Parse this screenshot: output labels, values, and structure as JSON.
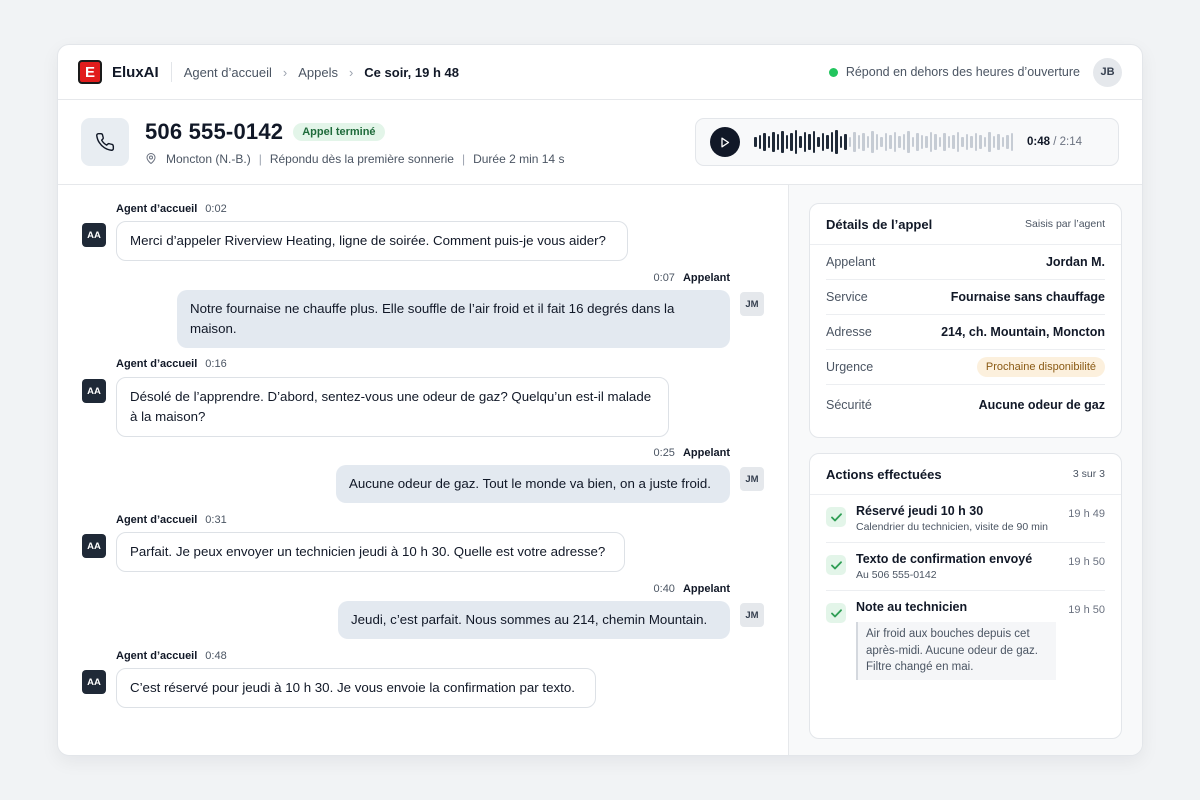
{
  "app": {
    "brand_letter": "E",
    "brand": "EluxAI",
    "brand_color": "#e11d1d"
  },
  "breadcrumb": [
    "Agent d’accueil",
    "Appels",
    "Ce soir, 19 h 48"
  ],
  "status": {
    "text": "Répond en dehors des heures d’ouverture",
    "color": "#22c55e"
  },
  "user": {
    "initials": "JB"
  },
  "call": {
    "number": "506 555-0142",
    "badge": "Appel terminé",
    "location": "Moncton (N.-B.)",
    "answered": "Répondu dès la première sonnerie",
    "duration": "Durée 2 min 14 s",
    "sep": "|"
  },
  "player": {
    "current": "0:48",
    "total": "/ 2:14",
    "progress": 0.36
  },
  "messages": [
    {
      "role": "agent",
      "speaker": "Agent d’accueil",
      "time": "0:02",
      "initials": "AA",
      "text": "Merci d’appeler Riverview Heating, ligne de soirée. Comment puis-je vous aider?"
    },
    {
      "role": "caller",
      "speaker": "Appelant",
      "time": "0:07",
      "initials": "JM",
      "text": "Notre fournaise ne chauffe plus. Elle souffle de l’air froid et il fait 16 degrés dans la maison."
    },
    {
      "role": "agent",
      "speaker": "Agent d’accueil",
      "time": "0:16",
      "initials": "AA",
      "text": "Désolé de l’apprendre. D’abord, sentez-vous une odeur de gaz? Quelqu’un est-il malade à la maison?"
    },
    {
      "role": "caller",
      "speaker": "Appelant",
      "time": "0:25",
      "initials": "JM",
      "text": "Aucune odeur de gaz. Tout le monde va bien, on a juste froid."
    },
    {
      "role": "agent",
      "speaker": "Agent d’accueil",
      "time": "0:31",
      "initials": "AA",
      "text": "Parfait. Je peux envoyer un technicien jeudi à 10 h 30. Quelle est votre adresse?"
    },
    {
      "role": "caller",
      "speaker": "Appelant",
      "time": "0:40",
      "initials": "JM",
      "text": "Jeudi, c’est parfait. Nous sommes au 214, chemin Mountain."
    },
    {
      "role": "agent",
      "speaker": "Agent d’accueil",
      "time": "0:48",
      "initials": "AA",
      "text": "C’est réservé pour jeudi à 10 h 30. Je vous envoie la confirmation par texto."
    }
  ],
  "details": {
    "title": "Détails de l’appel",
    "aside": "Saisis par l’agent",
    "rows": [
      {
        "label": "Appelant",
        "value": "Jordan M."
      },
      {
        "label": "Service",
        "value": "Fournaise sans chauffage"
      },
      {
        "label": "Adresse",
        "value": "214, ch. Mountain, Moncton"
      },
      {
        "label": "Urgence",
        "value": "Prochaine disponibilité"
      },
      {
        "label": "Sécurité",
        "value": "Aucune odeur de gaz"
      }
    ]
  },
  "actions": {
    "title": "Actions effectuées",
    "count": "3 sur 3",
    "items": [
      {
        "title": "Réservé jeudi 10 h 30",
        "sub": "Calendrier du technicien, visite de 90 min",
        "time": "19 h 49"
      },
      {
        "title": "Texto de confirmation envoyé",
        "sub": "Au 506 555-0142",
        "time": "19 h 50"
      },
      {
        "title": "Note au technicien",
        "time": "19 h 50",
        "note": "Air froid aux bouches depuis cet après-midi. Aucune odeur de gaz. Filtre changé en mai."
      }
    ]
  }
}
